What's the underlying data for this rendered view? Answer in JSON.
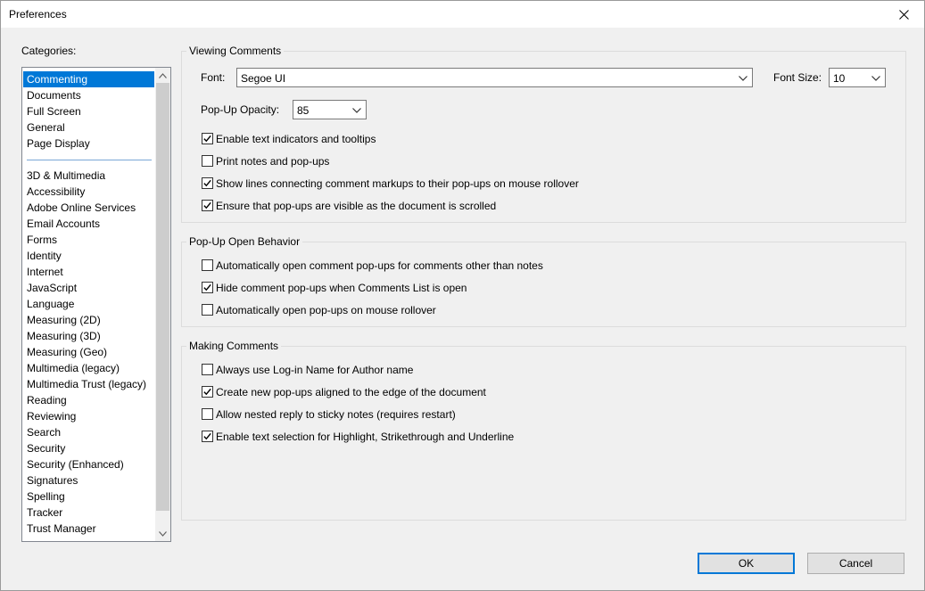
{
  "window": {
    "title": "Preferences"
  },
  "categories": {
    "label": "Categories:",
    "group1": [
      {
        "label": "Commenting",
        "selected": true
      },
      {
        "label": "Documents"
      },
      {
        "label": "Full Screen"
      },
      {
        "label": "General"
      },
      {
        "label": "Page Display"
      }
    ],
    "group2": [
      {
        "label": "3D & Multimedia"
      },
      {
        "label": "Accessibility"
      },
      {
        "label": "Adobe Online Services"
      },
      {
        "label": "Email Accounts"
      },
      {
        "label": "Forms"
      },
      {
        "label": "Identity"
      },
      {
        "label": "Internet"
      },
      {
        "label": "JavaScript"
      },
      {
        "label": "Language"
      },
      {
        "label": "Measuring (2D)"
      },
      {
        "label": "Measuring (3D)"
      },
      {
        "label": "Measuring (Geo)"
      },
      {
        "label": "Multimedia (legacy)"
      },
      {
        "label": "Multimedia Trust (legacy)"
      },
      {
        "label": "Reading"
      },
      {
        "label": "Reviewing"
      },
      {
        "label": "Search"
      },
      {
        "label": "Security"
      },
      {
        "label": "Security (Enhanced)"
      },
      {
        "label": "Signatures"
      },
      {
        "label": "Spelling"
      },
      {
        "label": "Tracker"
      },
      {
        "label": "Trust Manager"
      }
    ]
  },
  "viewing": {
    "title": "Viewing Comments",
    "font_label": "Font:",
    "font_value": "Segoe UI",
    "font_size_label": "Font Size:",
    "font_size_value": "10",
    "opacity_label": "Pop-Up Opacity:",
    "opacity_value": "85",
    "checks": [
      {
        "label": "Enable text indicators and tooltips",
        "checked": true
      },
      {
        "label": "Print notes and pop-ups",
        "checked": false
      },
      {
        "label": "Show lines connecting comment markups to their pop-ups on mouse rollover",
        "checked": true
      },
      {
        "label": "Ensure that pop-ups are visible as the document is scrolled",
        "checked": true
      }
    ]
  },
  "popup": {
    "title": "Pop-Up Open Behavior",
    "checks": [
      {
        "label": "Automatically open comment pop-ups for comments other than notes",
        "checked": false
      },
      {
        "label": "Hide comment pop-ups when Comments List is open",
        "checked": true
      },
      {
        "label": "Automatically open pop-ups on mouse rollover",
        "checked": false
      }
    ]
  },
  "making": {
    "title": "Making Comments",
    "checks": [
      {
        "label": "Always use Log-in Name for Author name",
        "checked": false
      },
      {
        "label": "Create new pop-ups aligned to the edge of the document",
        "checked": true
      },
      {
        "label": "Allow nested reply to sticky notes (requires restart)",
        "checked": false
      },
      {
        "label": "Enable text selection for Highlight, Strikethrough and Underline",
        "checked": true
      }
    ]
  },
  "buttons": {
    "ok": "OK",
    "cancel": "Cancel"
  },
  "colors": {
    "selection": "#0078d7",
    "background": "#f0f0f0"
  }
}
